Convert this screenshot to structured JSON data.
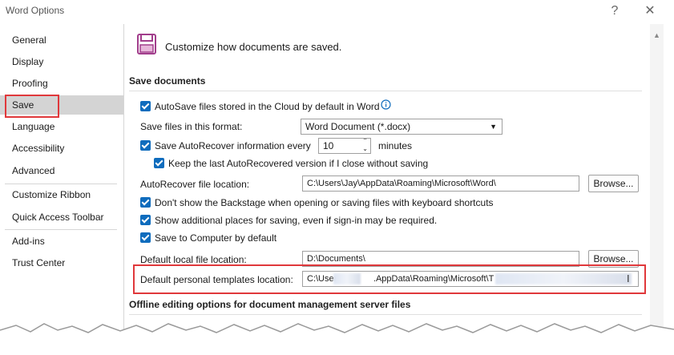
{
  "window": {
    "title": "Word Options",
    "help_label": "?",
    "close_label": "✕"
  },
  "sidebar": {
    "items": [
      {
        "label": "General"
      },
      {
        "label": "Display"
      },
      {
        "label": "Proofing"
      },
      {
        "label": "Save"
      },
      {
        "label": "Language"
      },
      {
        "label": "Accessibility"
      },
      {
        "label": "Advanced"
      },
      {
        "label": "Customize Ribbon"
      },
      {
        "label": "Quick Access Toolbar"
      },
      {
        "label": "Add-ins"
      },
      {
        "label": "Trust Center"
      }
    ],
    "selected": "Save"
  },
  "header": {
    "text": "Customize how documents are saved.",
    "icon": "save-disk-icon"
  },
  "save_documents": {
    "title": "Save documents",
    "autosave_label": "AutoSave files stored in the Cloud by default in Word",
    "format_label": "Save files in this format:",
    "format_value": "Word Document (*.docx)",
    "autorecover_label": "Save AutoRecover information every",
    "autorecover_minutes": "10",
    "minutes_label": "minutes",
    "keep_last_label": "Keep the last AutoRecovered version if I close without saving",
    "autorecover_location_label": "AutoRecover file location:",
    "autorecover_location_value": "C:\\Users\\Jay\\AppData\\Roaming\\Microsoft\\Word\\",
    "browse_label": "Browse...",
    "backstage_label": "Don't show the Backstage when opening or saving files with keyboard shortcuts",
    "additional_places_label": "Show additional places for saving, even if sign-in may be required.",
    "save_computer_label": "Save to Computer by default",
    "default_local_label": "Default local file location:",
    "default_local_value": "D:\\Documents\\",
    "browse2_label": "Browse...",
    "templates_label": "Default personal templates location:",
    "templates_value_prefix": "C:\\Users",
    "templates_value_mid": ".AppData\\Roaming\\Microsoft\\T"
  },
  "offline": {
    "title": "Offline editing options for document management server files"
  },
  "colors": {
    "checkbox": "#0f6cbd",
    "highlight": "#e0383b",
    "icon": "#a23e8c"
  }
}
